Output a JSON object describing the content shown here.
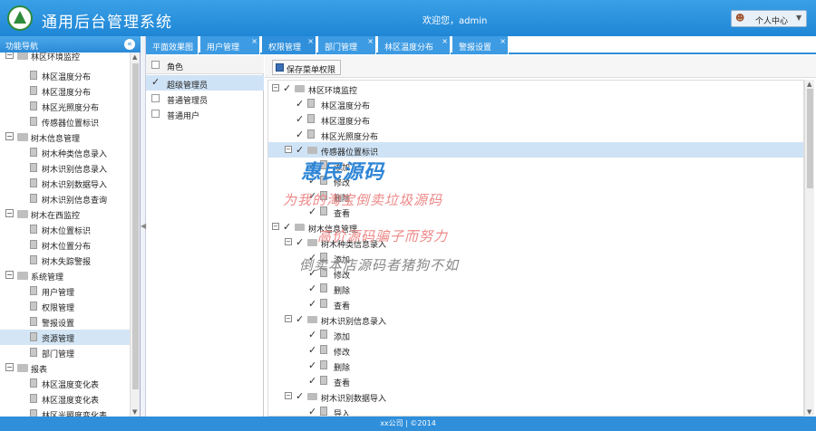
{
  "header": {
    "title": "通用后台管理系统",
    "welcome": "欢迎您，admin",
    "user_menu_label": "个人中心",
    "logo_icon": "tree-logo-icon",
    "user_icon": "user-icon"
  },
  "sidebar": {
    "title": "功能导航",
    "items": [
      {
        "label": "林区环境监控",
        "type": "group",
        "partial": true
      },
      {
        "label": "林区温度分布",
        "type": "leaf"
      },
      {
        "label": "林区湿度分布",
        "type": "leaf"
      },
      {
        "label": "林区光照度分布",
        "type": "leaf"
      },
      {
        "label": "传感器位置标识",
        "type": "leaf"
      },
      {
        "label": "树木信息管理",
        "type": "group"
      },
      {
        "label": "树木种类信息录入",
        "type": "leaf"
      },
      {
        "label": "树木识别信息录入",
        "type": "leaf"
      },
      {
        "label": "树木识别数据导入",
        "type": "leaf"
      },
      {
        "label": "树木识别信息查询",
        "type": "leaf"
      },
      {
        "label": "树木在西监控",
        "type": "group"
      },
      {
        "label": "树木位置标识",
        "type": "leaf"
      },
      {
        "label": "树木位置分布",
        "type": "leaf"
      },
      {
        "label": "树木失踪警报",
        "type": "leaf"
      },
      {
        "label": "系统管理",
        "type": "group"
      },
      {
        "label": "用户管理",
        "type": "leaf"
      },
      {
        "label": "权限管理",
        "type": "leaf"
      },
      {
        "label": "警报设置",
        "type": "leaf"
      },
      {
        "label": "资源管理",
        "type": "leaf",
        "selected": true
      },
      {
        "label": "部门管理",
        "type": "leaf"
      },
      {
        "label": "报表",
        "type": "group"
      },
      {
        "label": "林区温度变化表",
        "type": "leaf"
      },
      {
        "label": "林区湿度变化表",
        "type": "leaf"
      },
      {
        "label": "林区光照度变化表",
        "type": "leaf"
      }
    ]
  },
  "tabs": [
    {
      "label": "平面效果图",
      "closable": false
    },
    {
      "label": "用户管理",
      "closable": true
    },
    {
      "label": "权限管理",
      "closable": true,
      "active": true
    },
    {
      "label": "部门管理",
      "closable": true
    },
    {
      "label": "林区温度分布",
      "closable": true
    },
    {
      "label": "警报设置",
      "closable": true
    }
  ],
  "roles": {
    "header": "角色",
    "items": [
      {
        "label": "超级管理员",
        "checked": true,
        "selected": true
      },
      {
        "label": "普通管理员",
        "checked": false
      },
      {
        "label": "普通用户",
        "checked": false
      }
    ]
  },
  "permissions": {
    "save_label": "保存菜单权限",
    "tree": [
      {
        "label": "林区环境监控",
        "level": 0,
        "group": true,
        "checked": true
      },
      {
        "label": "林区温度分布",
        "level": 1,
        "checked": true
      },
      {
        "label": "林区湿度分布",
        "level": 1,
        "checked": true
      },
      {
        "label": "林区光照度分布",
        "level": 1,
        "checked": true
      },
      {
        "label": "传感器位置标识",
        "level": 1,
        "group": true,
        "checked": true,
        "selected": true
      },
      {
        "label": "添加",
        "level": 2,
        "checked": true
      },
      {
        "label": "修改",
        "level": 2,
        "checked": true
      },
      {
        "label": "删除",
        "level": 2,
        "checked": true
      },
      {
        "label": "查看",
        "level": 2,
        "checked": true
      },
      {
        "label": "树木信息管理",
        "level": 0,
        "group": true,
        "checked": true
      },
      {
        "label": "树木种类信息录入",
        "level": 1,
        "group": true,
        "checked": true
      },
      {
        "label": "添加",
        "level": 2,
        "checked": true
      },
      {
        "label": "修改",
        "level": 2,
        "checked": true
      },
      {
        "label": "删除",
        "level": 2,
        "checked": true
      },
      {
        "label": "查看",
        "level": 2,
        "checked": true
      },
      {
        "label": "树木识别信息录入",
        "level": 1,
        "group": true,
        "checked": true
      },
      {
        "label": "添加",
        "level": 2,
        "checked": true
      },
      {
        "label": "修改",
        "level": 2,
        "checked": true
      },
      {
        "label": "删除",
        "level": 2,
        "checked": true
      },
      {
        "label": "查看",
        "level": 2,
        "checked": true
      },
      {
        "label": "树木识别数据导入",
        "level": 1,
        "group": true,
        "checked": true
      },
      {
        "label": "导入",
        "level": 2,
        "checked": true
      }
    ]
  },
  "watermark": [
    {
      "text": "惠民源码",
      "color": "#2f86d6"
    },
    {
      "text": "为我的淘宝倒卖垃圾源码",
      "color": "#e88"
    },
    {
      "text": "高价源码骗子而努力",
      "color": "#e88"
    },
    {
      "text": "倒卖本店源码者猪狗不如",
      "color": "#888"
    }
  ],
  "footer": {
    "text": "xx公司 | ©2014"
  },
  "colors": {
    "header_blue": "#2a8ad8",
    "selection": "#cfe3f6"
  }
}
